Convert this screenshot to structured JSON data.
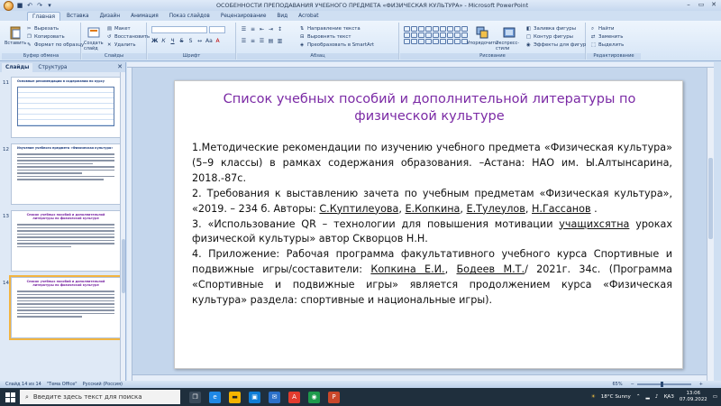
{
  "window": {
    "title": "ОСОБЕННОСТИ ПРЕПОДАВАНИЯ УЧЕБНОГО ПРЕДМЕТА «ФИЗИЧЕСКАЯ КУЛЬТУРА» - Microsoft PowerPoint",
    "minimize": "–",
    "maximize": "▭",
    "close": "✕"
  },
  "ribbon": {
    "tabs": [
      "Главная",
      "Вставка",
      "Дизайн",
      "Анимация",
      "Показ слайдов",
      "Рецензирование",
      "Вид",
      "Acrobat"
    ],
    "active_tab": "Главная",
    "clipboard": {
      "paste": "Вставить",
      "cut": "Вырезать",
      "copy": "Копировать",
      "format_painter": "Формат по образцу",
      "label": "Буфер обмена"
    },
    "slides": {
      "new_slide": "Создать слайд",
      "layout": "Макет",
      "reset": "Восстановить",
      "delete": "Удалить",
      "label": "Слайды"
    },
    "font": {
      "label": "Шрифт"
    },
    "paragraph": {
      "text_direction": "Направление текста",
      "align_text": "Выровнять текст",
      "smartart": "Преобразовать в SmartArt",
      "label": "Абзац"
    },
    "drawing": {
      "arrange": "Упорядочить",
      "quick_styles": "Экспресс-стили",
      "shape_fill": "Заливка фигуры",
      "shape_outline": "Контур фигуры",
      "shape_effects": "Эффекты для фигур",
      "label": "Рисование"
    },
    "editing": {
      "find": "Найти",
      "replace": "Заменить",
      "select": "Выделить",
      "label": "Редактирование"
    }
  },
  "left_panel": {
    "tab_slides": "Слайды",
    "tab_outline": "Структура",
    "close": "✕",
    "thumbnails": [
      {
        "num": "11",
        "title": "Основные рекомендации в содержании по курсу",
        "selected": false
      },
      {
        "num": "12",
        "title": "Изучение учебного предмета «Физическая культура»",
        "selected": false
      },
      {
        "num": "13",
        "title": "Список учебных пособий и дополнительной литературы по физической культуре",
        "selected": false
      },
      {
        "num": "14",
        "title": "Список учебных пособий и дополнительной литературы по физической культуре",
        "selected": true
      }
    ]
  },
  "slide": {
    "title": "Список учебных пособий и дополнительной литературы по физической культуре",
    "items": [
      {
        "pre": "1.Методические рекомендации по изучению учебного предмета «Физическая культура» (5–9 классы) в рамках содержания образования. –Астана: НАО им. Ы.Алтынсарина, 2018.-87с."
      },
      {
        "pre": "2. Требования к выставлению зачета по учебным предметам «Физическая культура», «2019. – 234 б.   Авторы: ",
        "authors": [
          "С.Куптилеуова",
          "Е.Копкина",
          "Е.Тулеулов",
          "Н.Гассанов"
        ],
        "post": " ."
      },
      {
        "pre": "3. «Использование QR – технологии для повышения мотивации ",
        "underlined": "учащихсятна",
        "post": " уроках физической культуры» автор Скворцов Н.Н."
      },
      {
        "pre": "4. Приложение: Рабочая программа факультативного учебного курса Спортивные и подвижные игры/составители: ",
        "authors": [
          "Копкина Е.И.",
          "Бодеев М.Т."
        ],
        "post": "/ 2021г. 34с. (Программа «Спортивные и подвижные игры» является продолжением курса «Физическая культура» раздела: спортивные и национальные игры)."
      }
    ]
  },
  "status_bar": {
    "slide_info": "Слайд 14 из 14",
    "theme": "\"Тема Office\"",
    "language": "Русский (Россия)",
    "zoom": "65%"
  },
  "taskbar": {
    "search_placeholder": "Введите здесь текст для поиска",
    "weather": "18°C  Sunny",
    "language": "ҚАЗ",
    "time": "13:06",
    "date": "07.09.2022"
  }
}
